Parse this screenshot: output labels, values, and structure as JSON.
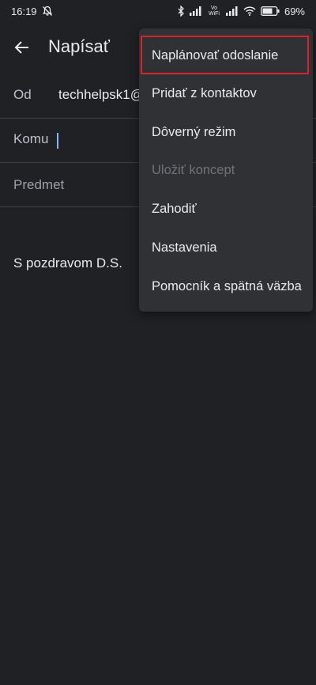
{
  "status_bar": {
    "time": "16:19",
    "battery_percent": "69%",
    "volte_label": "Vo WiFi",
    "icons": [
      "mute-bell-icon",
      "bluetooth-icon",
      "signal-icon",
      "vowifi-icon",
      "signal-icon",
      "wifi-icon",
      "battery-icon"
    ]
  },
  "header": {
    "back_icon": "arrow-back-icon",
    "title": "Napísať"
  },
  "compose": {
    "from_label": "Od",
    "from_value": "techhelpsk1@",
    "to_label": "Komu",
    "to_value": "",
    "subject_placeholder": "Predmet",
    "body_text": "S pozdravom D.S."
  },
  "menu": {
    "items": [
      {
        "label": "Naplánovať odoslanie",
        "enabled": true,
        "highlighted": true
      },
      {
        "label": "Pridať z kontaktov",
        "enabled": true
      },
      {
        "label": "Dôverný režim",
        "enabled": true
      },
      {
        "label": "Uložiť koncept",
        "enabled": false
      },
      {
        "label": "Zahodiť",
        "enabled": true
      },
      {
        "label": "Nastavenia",
        "enabled": true
      },
      {
        "label": "Pomocník a spätná väzba",
        "enabled": true
      }
    ]
  },
  "colors": {
    "background": "#202124",
    "menu_background": "#303134",
    "highlight_border": "#d8232a",
    "cursor": "#8ab4f8"
  }
}
